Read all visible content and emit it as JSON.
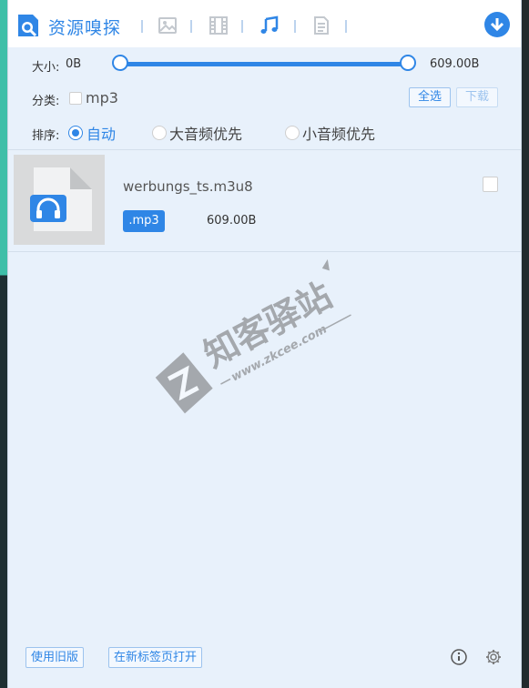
{
  "app": {
    "title": "资源嗅探"
  },
  "tabs": [
    {
      "icon": "image-icon",
      "active": false
    },
    {
      "icon": "video-icon",
      "active": false
    },
    {
      "icon": "music-icon",
      "active": true
    },
    {
      "icon": "document-icon",
      "active": false
    }
  ],
  "filters": {
    "size_label": "大小:",
    "size_min": "0B",
    "size_max": "609.00B",
    "category_label": "分类:",
    "category_option": "mp3",
    "select_all_label": "全选",
    "download_label": "下载",
    "sort_label": "排序:",
    "sort_options": [
      {
        "label": "自动",
        "selected": true
      },
      {
        "label": "大音频优先",
        "selected": false
      },
      {
        "label": "小音频优先",
        "selected": false
      }
    ]
  },
  "items": [
    {
      "name": "werbungs_ts.m3u8",
      "type": ".mp3",
      "size": "609.00B"
    }
  ],
  "watermark": {
    "brand": "知客驿站",
    "url": "www.zkcee.com"
  },
  "footer": {
    "old_version_label": "使用旧版",
    "open_new_tab_label": "在新标签页打开"
  },
  "colors": {
    "accent": "#2f86e6",
    "panel_bg": "#e8f1fb"
  }
}
